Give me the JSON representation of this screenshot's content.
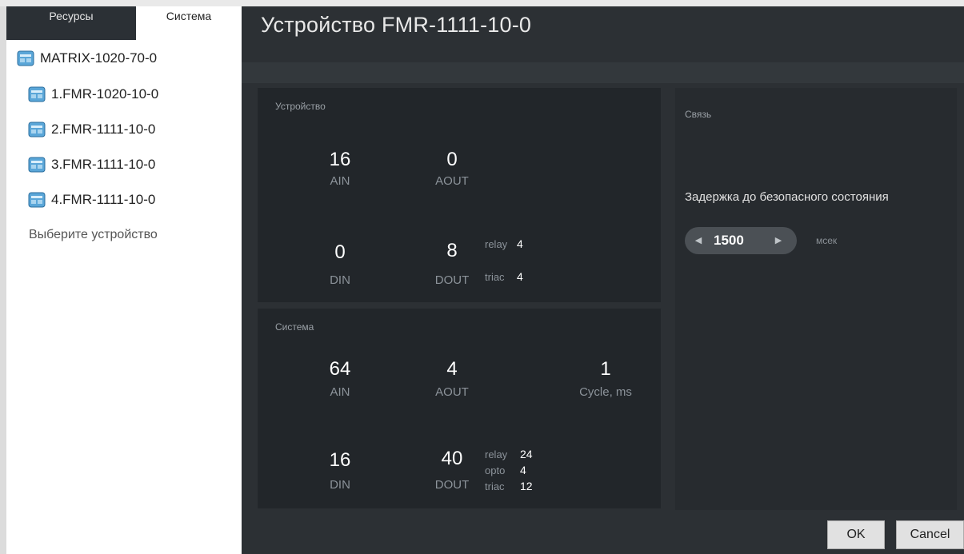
{
  "sidebar": {
    "tabs": [
      {
        "label": "Ресурсы"
      },
      {
        "label": "Система"
      }
    ],
    "tree": [
      {
        "label": "MATRIX-1020-70-0"
      },
      {
        "label": "1.FMR-1020-10-0"
      },
      {
        "label": "2.FMR-1111-10-0"
      },
      {
        "label": "3.FMR-1111-10-0"
      },
      {
        "label": "4.FMR-1111-10-0"
      }
    ],
    "hint": "Выберите устройство"
  },
  "main": {
    "title": "Устройство FMR-1111-10-0",
    "device": {
      "label": "Устройство",
      "ain": {
        "value": "16",
        "unit": "AIN"
      },
      "aout": {
        "value": "0",
        "unit": "AOUT"
      },
      "din": {
        "value": "0",
        "unit": "DIN"
      },
      "dout": {
        "value": "8",
        "unit": "DOUT"
      },
      "dout_breakdown": [
        {
          "label": "relay",
          "value": "4"
        },
        {
          "label": "triac",
          "value": "4"
        }
      ]
    },
    "system": {
      "label": "Система",
      "ain": {
        "value": "64",
        "unit": "AIN"
      },
      "aout": {
        "value": "4",
        "unit": "AOUT"
      },
      "cycle": {
        "value": "1",
        "unit": "Cycle, ms"
      },
      "din": {
        "value": "16",
        "unit": "DIN"
      },
      "dout": {
        "value": "40",
        "unit": "DOUT"
      },
      "dout_breakdown": [
        {
          "label": "relay",
          "value": "24"
        },
        {
          "label": "opto",
          "value": "4"
        },
        {
          "label": "triac",
          "value": "12"
        }
      ]
    },
    "link": {
      "label": "Связь",
      "delay_label": "Задержка до безопасного состояния",
      "delay_value": "1500",
      "delay_unit": "мсек"
    }
  },
  "buttons": {
    "ok": "OK",
    "cancel": "Cancel"
  },
  "colors": {
    "main_bg": "#2c3034",
    "panel_bg": "#22262a",
    "sidebar_bg": "#ffffff"
  }
}
